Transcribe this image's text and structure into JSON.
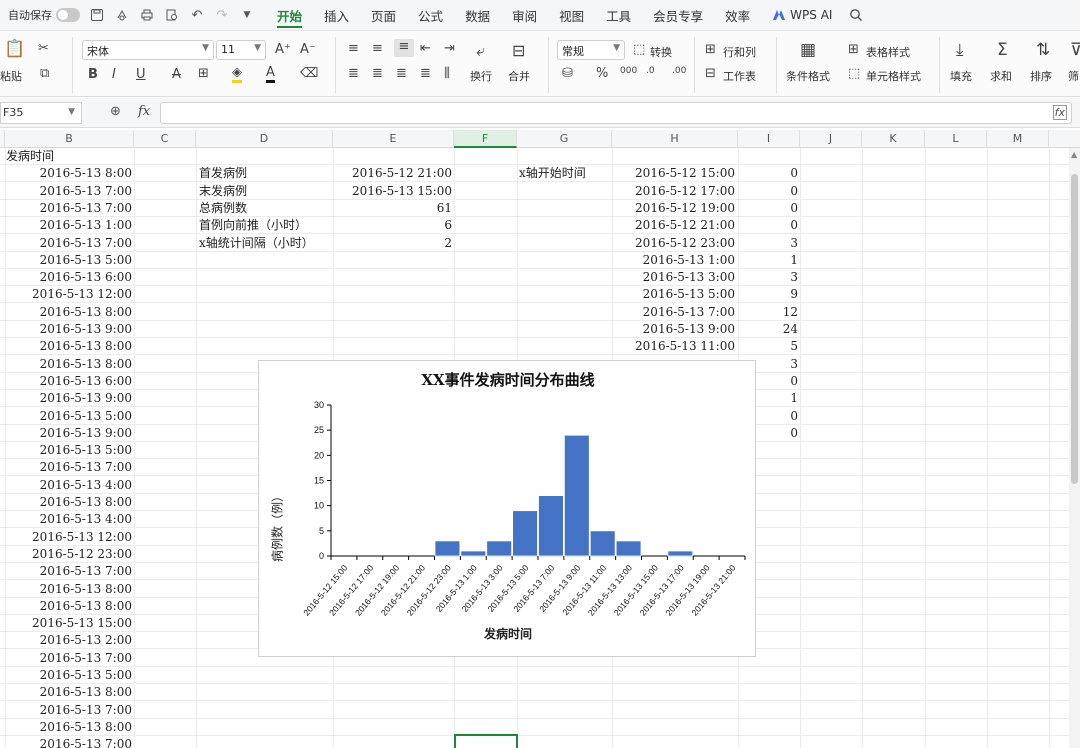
{
  "app": {
    "autosave_label": "自动保存",
    "menu_tabs": [
      "开始",
      "插入",
      "页面",
      "公式",
      "数据",
      "审阅",
      "视图",
      "工具",
      "会员专享",
      "效率"
    ],
    "active_tab": "开始",
    "wps_ai_label": "WPS AI"
  },
  "ribbon": {
    "paste_label": "粘贴",
    "font_name": "宋体",
    "font_size": "11",
    "wrap_label": "换行",
    "merge_label": "合并",
    "number_format": "常规",
    "convert_label": "转换",
    "rowcol_label": "行和列",
    "worksheet_label": "工作表",
    "cond_format_label": "条件格式",
    "table_style_label": "表格样式",
    "cell_style_label": "单元格样式",
    "fill_label": "填充",
    "sum_label": "求和",
    "sort_label": "排序",
    "filter_label": "筛"
  },
  "formula_bar": {
    "cell_ref": "F35",
    "fx_label": "fx",
    "content": ""
  },
  "columns": [
    "B",
    "C",
    "D",
    "E",
    "F",
    "G",
    "H",
    "I",
    "J",
    "K",
    "L",
    "M"
  ],
  "selected_column": "F",
  "sheet": {
    "b_header": "发病时间",
    "b_values": [
      "2016-5-13  8:00",
      "2016-5-13  7:00",
      "2016-5-13  7:00",
      "2016-5-13  1:00",
      "2016-5-13  7:00",
      "2016-5-13  5:00",
      "2016-5-13  6:00",
      "2016-5-13  12:00",
      "2016-5-13  8:00",
      "2016-5-13  9:00",
      "2016-5-13  8:00",
      "2016-5-13  8:00",
      "2016-5-13  6:00",
      "2016-5-13  9:00",
      "2016-5-13  5:00",
      "2016-5-13  9:00",
      "2016-5-13  5:00",
      "2016-5-13  7:00",
      "2016-5-13  4:00",
      "2016-5-13  8:00",
      "2016-5-13  4:00",
      "2016-5-13  12:00",
      "2016-5-12  23:00",
      "2016-5-13  7:00",
      "2016-5-13  8:00",
      "2016-5-13  8:00",
      "2016-5-13  15:00",
      "2016-5-13  2:00",
      "2016-5-13  7:00",
      "2016-5-13  5:00",
      "2016-5-13  8:00",
      "2016-5-13  7:00",
      "2016-5-13  8:00",
      "2016-5-13  7:00"
    ],
    "d_labels": [
      "首发病例",
      "末发病例",
      "总病例数",
      "首例向前推（小时）",
      "x轴统计间隔（小时）"
    ],
    "e_values": [
      "2016-5-12  21:00",
      "2016-5-13  15:00",
      "61",
      "6",
      "2"
    ],
    "g_label": "x轴开始时间",
    "h_values": [
      "2016-5-12  15:00",
      "2016-5-12  17:00",
      "2016-5-12  19:00",
      "2016-5-12  21:00",
      "2016-5-12  23:00",
      "2016-5-13  1:00",
      "2016-5-13  3:00",
      "2016-5-13  5:00",
      "2016-5-13  7:00",
      "2016-5-13  9:00",
      "2016-5-13  11:00"
    ],
    "i_values": [
      "0",
      "0",
      "0",
      "0",
      "3",
      "1",
      "3",
      "9",
      "12",
      "24",
      "5",
      "3",
      "0",
      "1",
      "0",
      "0"
    ]
  },
  "chart_data": {
    "type": "bar",
    "title": "XX事件发病时间分布曲线",
    "xlabel": "发病时间",
    "ylabel": "病例数（例）",
    "categories": [
      "2016-5-12 15:00",
      "2016-5-12 17:00",
      "2016-5-12 19:00",
      "2016-5-12 21:00",
      "2016-5-12 23:00",
      "2016-5-13 1:00",
      "2016-5-13 3:00",
      "2016-5-13 5:00",
      "2016-5-13 7:00",
      "2016-5-13 9:00",
      "2016-5-13 11:00",
      "2016-5-13 13:00",
      "2016-5-13 15:00",
      "2016-5-13 17:00",
      "2016-5-13 19:00",
      "2016-5-13 21:00"
    ],
    "values": [
      0,
      0,
      0,
      0,
      3,
      1,
      3,
      9,
      12,
      24,
      5,
      3,
      0,
      1,
      0,
      0
    ],
    "ylim": [
      0,
      30
    ],
    "yticks": [
      0,
      5,
      10,
      15,
      20,
      25,
      30
    ],
    "bar_color": "#4472c4",
    "grid": false,
    "legend": "none"
  }
}
